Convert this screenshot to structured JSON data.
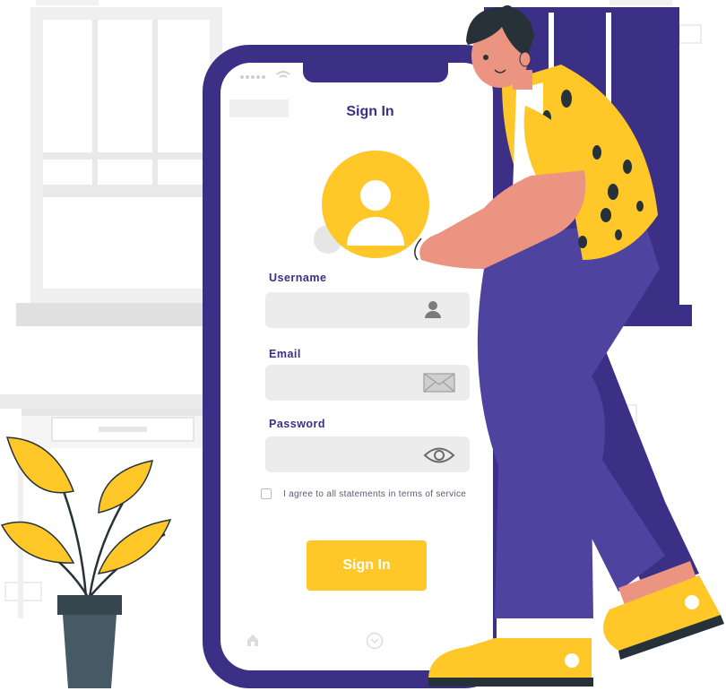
{
  "screen": {
    "title": "Sign In"
  },
  "form": {
    "username_label": "Username",
    "email_label": "Email",
    "password_label": "Password",
    "agree_text": "I agree to all statements in terms of service",
    "agree_checked": false,
    "submit_label": "Sign In"
  },
  "icons": {
    "username": "person-icon",
    "email": "envelope-icon",
    "password": "eye-icon",
    "nav_home": "home-icon",
    "nav_down": "chevron-down-circle-icon"
  },
  "colors": {
    "brand_purple": "#3b2f86",
    "accent_yellow": "#ffc727",
    "skin": "#eb9481",
    "field_bg": "#ececec"
  }
}
